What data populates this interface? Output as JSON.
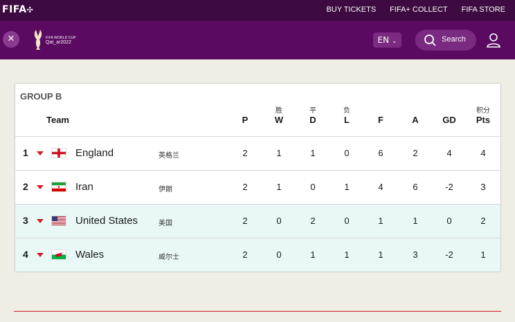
{
  "topbar": {
    "logo": "FIFA",
    "links": [
      "BUY TICKETS",
      "FIFA+ COLLECT",
      "FIFA STORE"
    ]
  },
  "navbar": {
    "close_icon": "close-icon",
    "wc_logo_line1": "FIFA WORLD CUP",
    "wc_logo_line2": "Qat_ar2022",
    "language": "EN",
    "search_label": "Search",
    "user_icon": "user-icon"
  },
  "standings": {
    "group_title": "GROUP B",
    "team_header": "Team",
    "columns": [
      {
        "cn": "",
        "label": "P"
      },
      {
        "cn": "胜",
        "label": "W"
      },
      {
        "cn": "平",
        "label": "D"
      },
      {
        "cn": "负",
        "label": "L"
      },
      {
        "cn": "",
        "label": "F"
      },
      {
        "cn": "",
        "label": "A"
      },
      {
        "cn": "",
        "label": "GD"
      },
      {
        "cn": "积分",
        "label": "Pts"
      }
    ],
    "rows": [
      {
        "pos": "1",
        "team": "England",
        "cn": "英格兰",
        "flag": "england-flag",
        "stats": [
          "2",
          "1",
          "1",
          "0",
          "6",
          "2",
          "4",
          "4"
        ],
        "qualified": false
      },
      {
        "pos": "2",
        "team": "Iran",
        "cn": "伊朗",
        "flag": "iran-flag",
        "stats": [
          "2",
          "1",
          "0",
          "1",
          "4",
          "6",
          "-2",
          "3"
        ],
        "qualified": false
      },
      {
        "pos": "3",
        "team": "United States",
        "cn": "美国",
        "flag": "usa-flag",
        "stats": [
          "2",
          "0",
          "2",
          "0",
          "1",
          "1",
          "0",
          "2"
        ],
        "qualified": true
      },
      {
        "pos": "4",
        "team": "Wales",
        "cn": "威尔士",
        "flag": "wales-flag",
        "stats": [
          "2",
          "0",
          "1",
          "1",
          "1",
          "3",
          "-2",
          "1"
        ],
        "qualified": true
      }
    ]
  },
  "colors": {
    "topbar": "#3d0a41",
    "navbar": "#5b0a62",
    "accent_red": "#d31a2a",
    "qualified_row": "#e9f8f6"
  }
}
